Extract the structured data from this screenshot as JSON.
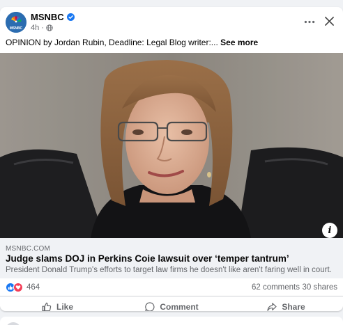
{
  "post": {
    "page_name": "MSNBC",
    "avatar_text": "MSNBC",
    "timestamp": "4h",
    "separator": "·",
    "text": "OPINION by Jordan Rubin, Deadline: Legal Blog writer:...",
    "see_more": "See more",
    "more_icon": "more-horizontal-icon",
    "close_icon": "close-icon"
  },
  "link": {
    "domain": "MSNBC.COM",
    "title": "Judge slams DOJ in Perkins Coie lawsuit over ‘temper tantrum’",
    "description": "President Donald Trump's efforts to target law firms he doesn't like aren't faring well in court.",
    "info_glyph": "i"
  },
  "stats": {
    "reactions_count": "464",
    "comments": "62 comments",
    "shares": "30 shares"
  },
  "actions": {
    "like": "Like",
    "comment": "Comment",
    "share": "Share"
  },
  "colors": {
    "brand_blue": "#1877f2",
    "love_red": "#f33e58",
    "secondary_text": "#65676b",
    "link_box_bg": "#f0f2f5"
  }
}
